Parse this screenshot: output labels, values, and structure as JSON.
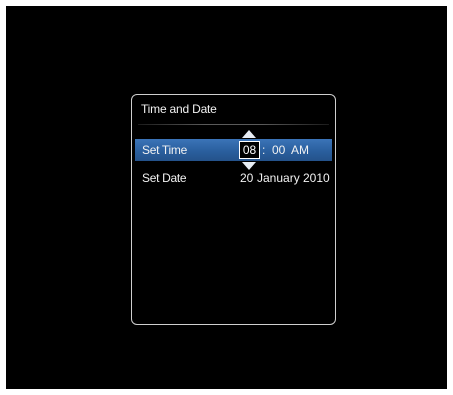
{
  "colors": {
    "background": "#000000",
    "outer_frame": "#ffffff",
    "selection": "#2f66a8",
    "text": "#f2f2f2",
    "dialog_border": "#cfcfcf"
  },
  "dialog": {
    "title": "Time and Date"
  },
  "rows": {
    "time": {
      "label": "Set Time",
      "hour": "08",
      "separator": ":",
      "minute": "00",
      "ampm": "AM",
      "up_icon": "triangle-up-icon",
      "down_icon": "triangle-down-icon"
    },
    "date": {
      "label": "Set Date",
      "day": "20",
      "month": "January",
      "year": "2010"
    }
  }
}
